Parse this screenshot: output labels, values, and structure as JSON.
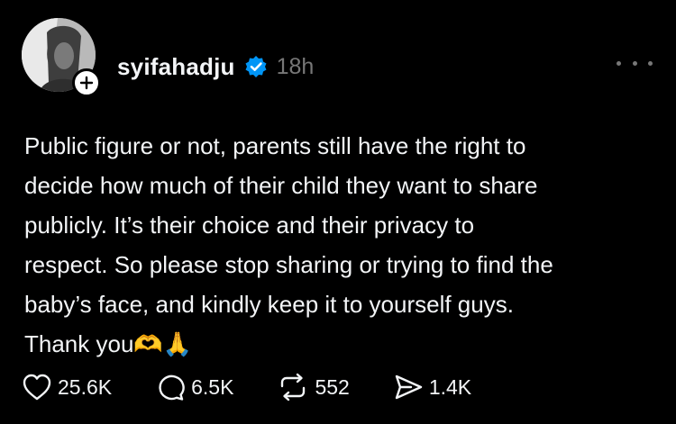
{
  "post": {
    "username": "syifahadju",
    "verified": true,
    "time": "18h",
    "follow_symbol": "+",
    "text_lines": [
      "Public figure or not, parents still have the right to",
      "decide how much of their child they want to share",
      "publicly. It’s their choice and their privacy to",
      "respect. So please stop sharing or trying to find the",
      "baby’s face, and kindly keep it to yourself guys.",
      "Thank you🫶🙏"
    ]
  },
  "actions": {
    "likes": "25.6K",
    "replies": "6.5K",
    "reposts": "552",
    "shares": "1.4K"
  },
  "icons": {
    "like": "heart-icon",
    "reply": "comment-bubble-icon",
    "repost": "repost-icon",
    "share": "send-icon",
    "more": "more-dots-icon",
    "verified": "verified-badge-icon",
    "follow": "plus-icon"
  },
  "colors": {
    "background": "#000000",
    "text": "#f3f5f7",
    "muted": "#777777",
    "verified": "#0095f6"
  }
}
